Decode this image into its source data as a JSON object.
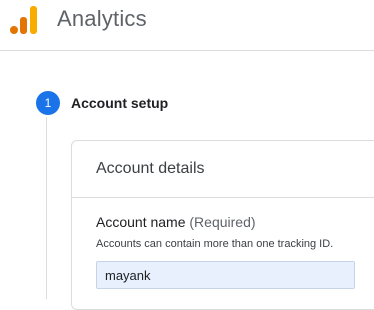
{
  "app": {
    "title": "Analytics",
    "logo_icon": "analytics-logo"
  },
  "stepper": {
    "step_number": "1",
    "step_title": "Account setup",
    "accent_color": "#1a73e8"
  },
  "account_details": {
    "title": "Account details",
    "account_name_label": "Account name",
    "account_name_required": "(Required)",
    "account_name_hint": "Accounts can contain more than one tracking ID.",
    "account_name_value": "mayank"
  }
}
